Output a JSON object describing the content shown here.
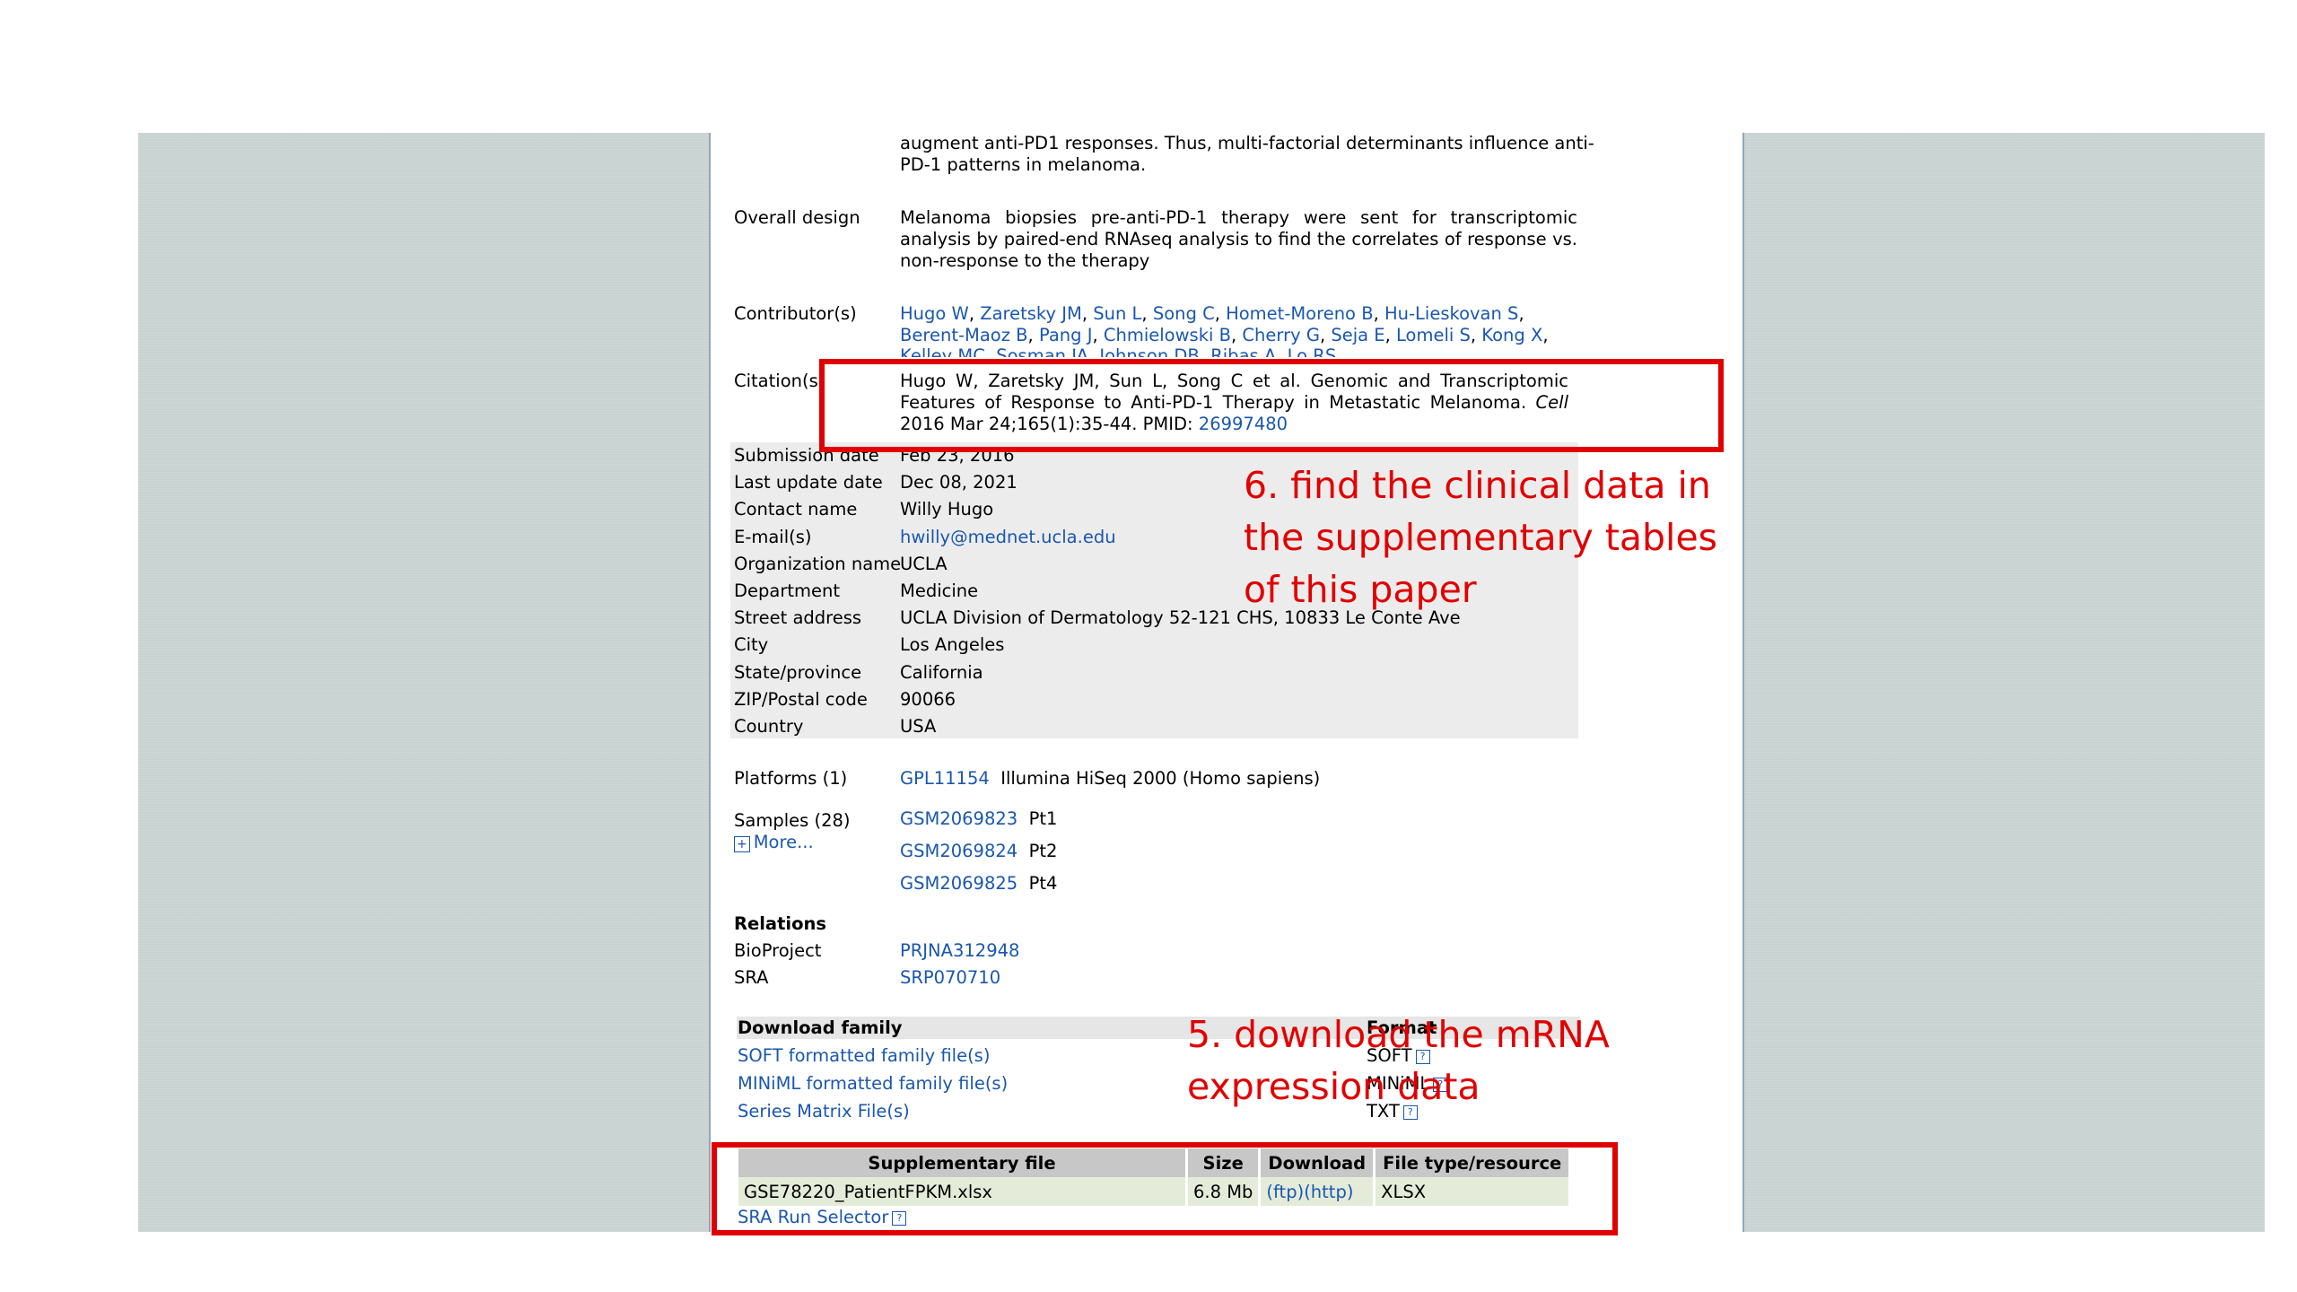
{
  "summary": {
    "line1": "augment anti-PD1 responses. Thus, multi-factorial determinants influence anti-",
    "line2": "PD-1 patterns in melanoma."
  },
  "overall_design": {
    "label": "Overall design",
    "text": "Melanoma biopsies pre-anti-PD-1 therapy were sent for transcriptomic analysis by paired-end RNAseq analysis to find the correlates of response vs. non-response to the therapy"
  },
  "contributors": {
    "label": "Contributor(s)",
    "line1": [
      "Hugo W",
      "Zaretsky JM",
      "Sun L",
      "Song C",
      "Homet-Moreno B",
      "Hu-Lieskovan S"
    ],
    "line2": [
      "Berent-Maoz B",
      "Pang J",
      "Chmielowski B",
      "Cherry G",
      "Seja E",
      "Lomeli S",
      "Kong X"
    ],
    "line3": [
      "Kelley MC",
      "Sosman JA",
      "Johnson DB",
      "Ribas A",
      "Lo RS"
    ]
  },
  "citation": {
    "label": "Citation(s)",
    "authors": "Hugo W, Zaretsky JM, Sun L, Song C et al. Genomic and Transcriptomic Features of Response to Anti-PD-1 Therapy in Metastatic Melanoma. ",
    "journal": "Cell",
    "year": " 2016 Mar 24;165(1):35-44. PMID: ",
    "pmid": "26997480"
  },
  "contact": [
    {
      "label": "Submission date",
      "value": "Feb 23, 2016",
      "link": false
    },
    {
      "label": "Last update date",
      "value": "Dec 08, 2021",
      "link": false
    },
    {
      "label": "Contact name",
      "value": "Willy Hugo",
      "link": false
    },
    {
      "label": "E-mail(s)",
      "value": "hwilly@mednet.ucla.edu",
      "link": true
    },
    {
      "label": "Organization name",
      "value": "UCLA",
      "link": false
    },
    {
      "label": "Department",
      "value": "Medicine",
      "link": false
    },
    {
      "label": "Street address",
      "value": "UCLA Division of Dermatology 52-121 CHS, 10833 Le Conte Ave",
      "link": false
    },
    {
      "label": "City",
      "value": "Los Angeles",
      "link": false
    },
    {
      "label": "State/province",
      "value": "California",
      "link": false
    },
    {
      "label": "ZIP/Postal code",
      "value": "90066",
      "link": false
    },
    {
      "label": "Country",
      "value": "USA",
      "link": false
    }
  ],
  "platforms": {
    "label": "Platforms (1)",
    "id": "GPL11154",
    "desc": "Illumina HiSeq 2000 (Homo sapiens)"
  },
  "samples": {
    "label": "Samples (28)",
    "more_icon": "+",
    "more": "More...",
    "items": [
      {
        "id": "GSM2069823",
        "name": "Pt1"
      },
      {
        "id": "GSM2069824",
        "name": "Pt2"
      },
      {
        "id": "GSM2069825",
        "name": "Pt4"
      }
    ]
  },
  "relations": {
    "heading": "Relations",
    "bioproject_label": "BioProject",
    "bioproject": "PRJNA312948",
    "sra_label": "SRA",
    "sra": "SRP070710"
  },
  "download_family": {
    "heading": "Download family",
    "format_heading": "Format",
    "rows": [
      {
        "label": "SOFT formatted family file(s)",
        "format": "SOFT"
      },
      {
        "label": "MINiML formatted family file(s)",
        "format": "MINiML"
      },
      {
        "label": "Series Matrix File(s)",
        "format": "TXT"
      }
    ]
  },
  "supplementary": {
    "headers": [
      "Supplementary file",
      "Size",
      "Download",
      "File type/resource"
    ],
    "file": "GSE78220_PatientFPKM.xlsx",
    "size": "6.8 Mb",
    "ftp": "(ftp)",
    "http": "(http)",
    "type": "XLSX",
    "sra_selector": "SRA Run Selector"
  },
  "annotations": {
    "note6_line1": "6. find the clinical data in",
    "note6_line2": "the supplementary tables",
    "note6_line3": "of this paper",
    "note5_line1": "5. download the mRNA",
    "note5_line2": "expression data",
    "color": "#e10000"
  }
}
